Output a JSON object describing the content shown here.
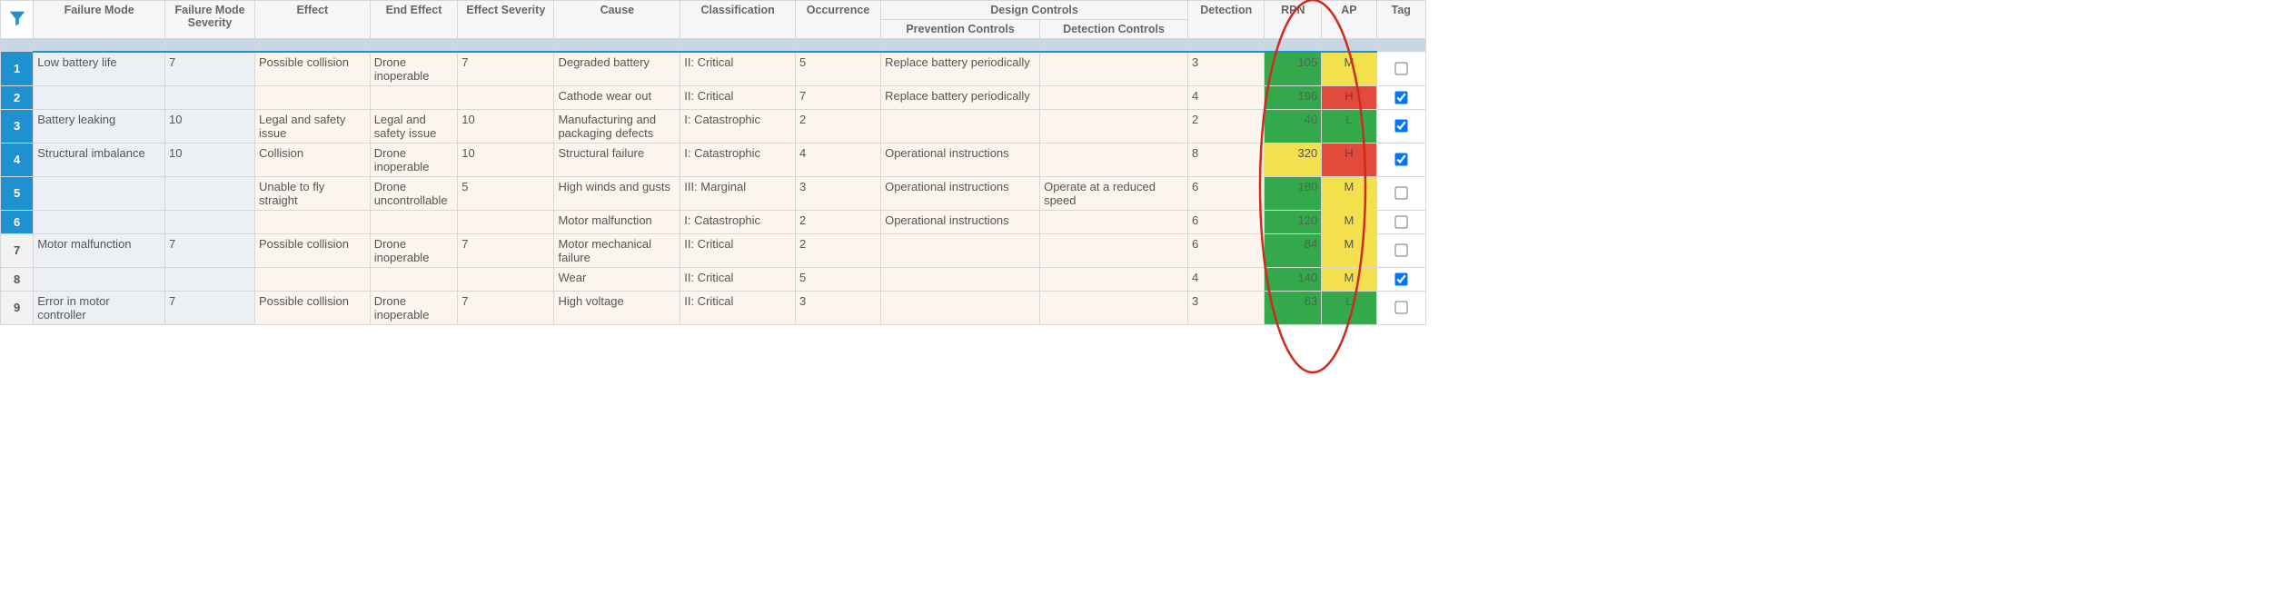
{
  "columns": {
    "failure_mode": "Failure Mode",
    "failure_mode_severity": "Failure Mode Severity",
    "effect": "Effect",
    "end_effect": "End Effect",
    "effect_severity": "Effect Severity",
    "cause": "Cause",
    "classification": "Classification",
    "occurrence": "Occurrence",
    "design_controls": "Design Controls",
    "prevention_controls": "Prevention Controls",
    "detection_controls": "Detection Controls",
    "detection": "Detection",
    "rpn": "RPN",
    "ap": "AP",
    "tag": "Tag"
  },
  "rows": [
    {
      "n": "1",
      "selected": true,
      "failure_mode": "Low battery life",
      "fm_sev": "7",
      "effect": "Possible collision",
      "end_effect": "Drone inoperable",
      "eff_sev": "7",
      "cause": "Degraded battery",
      "classification": "II: Critical",
      "occurrence": "5",
      "prevention": "Replace battery periodically",
      "detection_ctrl": "",
      "detection": "3",
      "rpn": "105",
      "rpn_color": "green",
      "ap": "M",
      "ap_color": "yellow",
      "tag": false
    },
    {
      "n": "2",
      "selected": true,
      "failure_mode": "",
      "fm_sev": "",
      "effect": "",
      "end_effect": "",
      "eff_sev": "",
      "cause": "Cathode wear out",
      "classification": "II: Critical",
      "occurrence": "7",
      "prevention": "Replace battery periodically",
      "detection_ctrl": "",
      "detection": "4",
      "rpn": "196",
      "rpn_color": "green",
      "ap": "H",
      "ap_color": "red",
      "tag": true
    },
    {
      "n": "3",
      "selected": true,
      "failure_mode": "Battery leaking",
      "fm_sev": "10",
      "effect": "Legal and safety issue",
      "end_effect": "Legal and safety issue",
      "eff_sev": "10",
      "cause": "Manufacturing and packaging defects",
      "classification": "I: Catastrophic",
      "occurrence": "2",
      "prevention": "",
      "detection_ctrl": "",
      "detection": "2",
      "rpn": "40",
      "rpn_color": "green",
      "ap": "L",
      "ap_color": "green",
      "tag": true
    },
    {
      "n": "4",
      "selected": true,
      "failure_mode": "Structural imbalance",
      "fm_sev": "10",
      "effect": "Collision",
      "end_effect": "Drone inoperable",
      "eff_sev": "10",
      "cause": "Structural failure",
      "classification": "I: Catastrophic",
      "occurrence": "4",
      "prevention": "Operational instructions",
      "detection_ctrl": "",
      "detection": "8",
      "rpn": "320",
      "rpn_color": "yellow",
      "ap": "H",
      "ap_color": "red",
      "tag": true
    },
    {
      "n": "5",
      "selected": true,
      "failure_mode": "",
      "fm_sev": "",
      "effect": "Unable to fly straight",
      "end_effect": "Drone uncontrollable",
      "eff_sev": "5",
      "cause": "High winds and gusts",
      "classification": "III: Marginal",
      "occurrence": "3",
      "prevention": "Operational instructions",
      "detection_ctrl": "Operate at a reduced speed",
      "detection": "6",
      "rpn": "180",
      "rpn_color": "green",
      "ap": "M",
      "ap_color": "yellow",
      "tag": false
    },
    {
      "n": "6",
      "selected": true,
      "failure_mode": "",
      "fm_sev": "",
      "effect": "",
      "end_effect": "",
      "eff_sev": "",
      "cause": "Motor malfunction",
      "classification": "I: Catastrophic",
      "occurrence": "2",
      "prevention": "Operational instructions",
      "detection_ctrl": "",
      "detection": "6",
      "rpn": "120",
      "rpn_color": "green",
      "ap": "M",
      "ap_color": "yellow",
      "tag": false
    },
    {
      "n": "7",
      "selected": false,
      "failure_mode": "Motor malfunction",
      "fm_sev": "7",
      "effect": "Possible collision",
      "end_effect": "Drone inoperable",
      "eff_sev": "7",
      "cause": "Motor mechanical failure",
      "classification": "II: Critical",
      "occurrence": "2",
      "prevention": "",
      "detection_ctrl": "",
      "detection": "6",
      "rpn": "84",
      "rpn_color": "green",
      "ap": "M",
      "ap_color": "yellow",
      "tag": false
    },
    {
      "n": "8",
      "selected": false,
      "failure_mode": "",
      "fm_sev": "",
      "effect": "",
      "end_effect": "",
      "eff_sev": "",
      "cause": "Wear",
      "classification": "II: Critical",
      "occurrence": "5",
      "prevention": "",
      "detection_ctrl": "",
      "detection": "4",
      "rpn": "140",
      "rpn_color": "green",
      "ap": "M",
      "ap_color": "yellow",
      "tag": true
    },
    {
      "n": "9",
      "selected": false,
      "failure_mode": "Error in motor controller",
      "fm_sev": "7",
      "effect": "Possible collision",
      "end_effect": "Drone inoperable",
      "eff_sev": "7",
      "cause": "High voltage",
      "classification": "II: Critical",
      "occurrence": "3",
      "prevention": "",
      "detection_ctrl": "",
      "detection": "3",
      "rpn": "63",
      "rpn_color": "green",
      "ap": "L",
      "ap_color": "green",
      "tag": false
    }
  ]
}
